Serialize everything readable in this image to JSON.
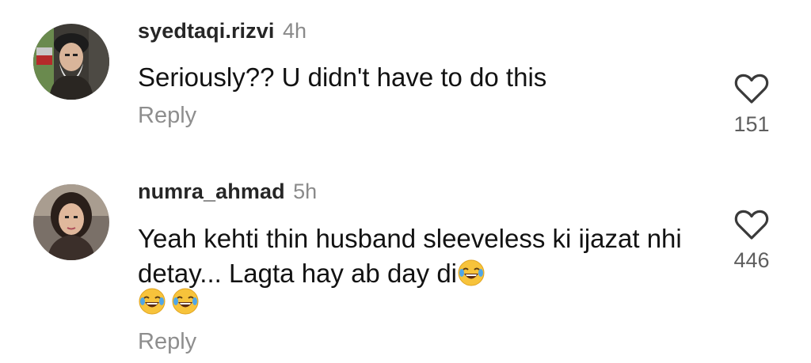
{
  "comments": [
    {
      "username": "syedtaqi.rizvi",
      "time": "4h",
      "text": "Seriously?? U didn't have to do this",
      "likes": "151",
      "reply_label": "Reply",
      "avatar_icon": "user-avatar-photo"
    },
    {
      "username": "numra_ahmad",
      "time": "5h",
      "text": "Yeah kehti thin husband sleeveless ki ijazat nhi detay... Lagta hay ab day di",
      "trailing_emoji": "😂",
      "extra_emojis": [
        "😂",
        "😂"
      ],
      "likes": "446",
      "reply_label": "Reply",
      "avatar_icon": "user-avatar-photo"
    }
  ],
  "icons": {
    "like": "heart-outline-icon",
    "emoji": "face-with-tears-of-joy"
  },
  "colors": {
    "username": "#262626",
    "meta": "#8e8e8e",
    "text": "#121212",
    "heart_stroke": "#3a3a3a"
  }
}
